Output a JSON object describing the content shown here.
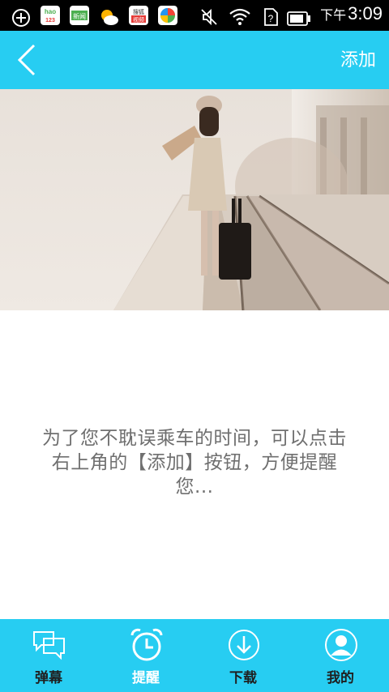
{
  "status_bar": {
    "time_prefix": "下午",
    "time": "3:09",
    "apps": [
      {
        "name": "add-app-icon",
        "label": ""
      },
      {
        "name": "hao123-app-icon",
        "label": "hao 123"
      },
      {
        "name": "news-app-icon",
        "label": "新闻"
      },
      {
        "name": "weather-app-icon",
        "label": ""
      },
      {
        "name": "sohu-video-app-icon",
        "label": "搜狐视频"
      },
      {
        "name": "game-center-app-icon",
        "label": ""
      }
    ]
  },
  "header": {
    "back_icon": "chevron-left-icon",
    "add_label": "添加"
  },
  "hero": {
    "description": "woman-with-suitcase-on-railway-platform"
  },
  "message": {
    "line1": "为了您不耽误乘车的时间，可以点击",
    "line2": "右上角的【添加】按钮，方便提醒",
    "line3": "您..."
  },
  "tabs": [
    {
      "label": "弹幕",
      "icon": "chat-bubbles-icon",
      "active": false
    },
    {
      "label": "提醒",
      "icon": "alarm-clock-icon",
      "active": true
    },
    {
      "label": "下载",
      "icon": "download-icon",
      "active": false
    },
    {
      "label": "我的",
      "icon": "person-icon",
      "active": false
    }
  ],
  "colors": {
    "accent": "#27cdf2",
    "message_text": "#6f6f6f",
    "tab_label": "#1f1f1f",
    "tab_label_active": "#ffffff"
  }
}
